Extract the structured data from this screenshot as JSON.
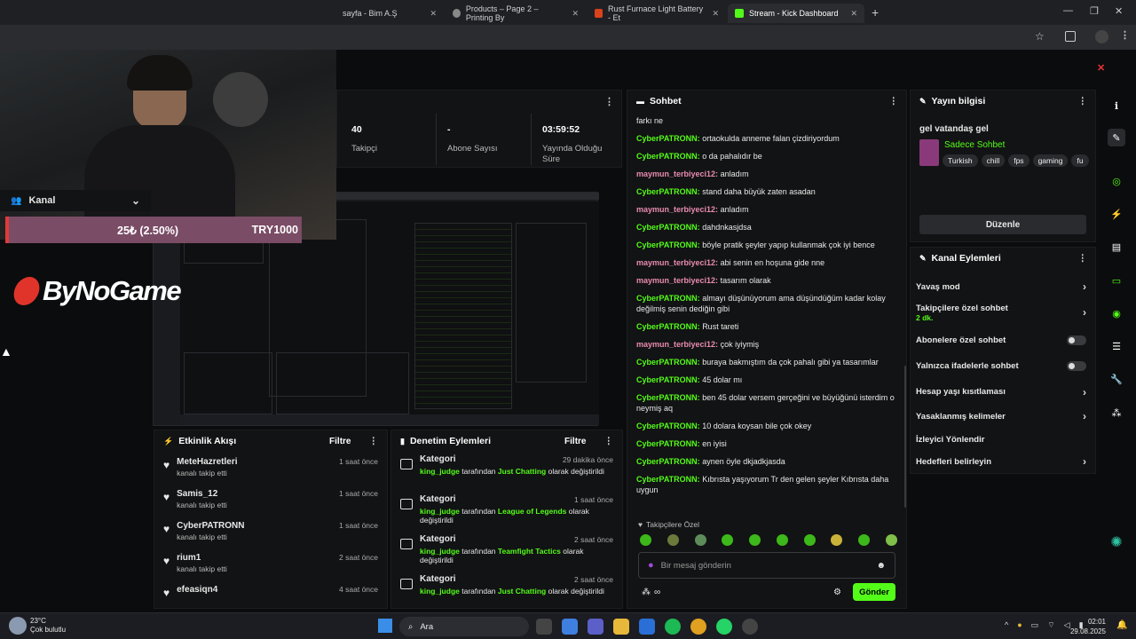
{
  "browser": {
    "tabs": [
      {
        "label": "sayfa - Bim A.Ş",
        "active": false
      },
      {
        "label": "Products – Page 2 – Printing By",
        "active": false
      },
      {
        "label": "Rust Furnace Light Battery - Et",
        "active": false
      },
      {
        "label": "Stream - Kick Dashboard",
        "active": true
      }
    ]
  },
  "overlay": {
    "section_label": "Kanal",
    "donation_amount": "25₺ (2.50%)",
    "donation_goal": "TRY1000",
    "brand_text": "ByNoGame"
  },
  "stats": [
    {
      "value": "40",
      "label": "Takipçi"
    },
    {
      "value": "-",
      "label": "Abone Sayısı"
    },
    {
      "value": "03:59:52",
      "label": "Yayında Olduğu Süre"
    }
  ],
  "activity": {
    "title": "Etkinlik Akışı",
    "filter": "Filtre",
    "items": [
      {
        "name": "MeteHazretleri",
        "action": "kanalı takip etti",
        "time": "1 saat önce"
      },
      {
        "name": "Samis_12",
        "action": "kanalı takip etti",
        "time": "1 saat önce"
      },
      {
        "name": "CyberPATRONN",
        "action": "kanalı takip etti",
        "time": "1 saat önce"
      },
      {
        "name": "rium1",
        "action": "kanalı takip etti",
        "time": "2 saat önce"
      },
      {
        "name": "efeasiqn4",
        "action": "",
        "time": "4 saat önce"
      }
    ]
  },
  "moderation": {
    "title": "Denetim Eylemleri",
    "filter": "Filtre",
    "items": [
      {
        "title": "Kategori",
        "time": "29 dakika önce",
        "user": "king_judge",
        "mid": "tarafından",
        "target": "Just Chatting",
        "suffix": "olarak değiştirildi"
      },
      {
        "title": "Kategori",
        "time": "1 saat önce",
        "user": "king_judge",
        "mid": "tarafından",
        "target": "League of Legends",
        "suffix": "olarak değiştirildi"
      },
      {
        "title": "Kategori",
        "time": "2 saat önce",
        "user": "king_judge",
        "mid": "tarafından",
        "target": "Teamfight Tactics",
        "suffix": "olarak değiştirildi"
      },
      {
        "title": "Kategori",
        "time": "2 saat önce",
        "user": "king_judge",
        "mid": "tarafından",
        "target": "Just Chatting",
        "suffix": "olarak değiştirildi"
      }
    ]
  },
  "chat": {
    "title": "Sohbet",
    "messages": [
      {
        "user": "",
        "text": "farkı ne",
        "color": "green"
      },
      {
        "user": "CyberPATRONN:",
        "text": "ortaokulda anneme falan çizdiriyordum",
        "color": "green"
      },
      {
        "user": "CyberPATRONN:",
        "text": "o da pahalıdır be",
        "color": "green"
      },
      {
        "user": "maymun_terbiyeci12:",
        "text": "anladım",
        "color": "pink"
      },
      {
        "user": "CyberPATRONN:",
        "text": "stand daha büyük zaten asadan",
        "color": "green"
      },
      {
        "user": "maymun_terbiyeci12:",
        "text": "anladım",
        "color": "pink"
      },
      {
        "user": "CyberPATRONN:",
        "text": "dahdnkasjdsa",
        "color": "green"
      },
      {
        "user": "CyberPATRONN:",
        "text": "böyle pratik şeyler yapıp kullanmak çok iyi bence",
        "color": "green"
      },
      {
        "user": "maymun_terbiyeci12:",
        "text": "abi senin en hoşuna gide nne",
        "color": "pink"
      },
      {
        "user": "maymun_terbiyeci12:",
        "text": "tasarım olarak",
        "color": "pink"
      },
      {
        "user": "CyberPATRONN:",
        "text": "almayı düşünüyorum ama düşündüğüm kadar kolay değilmiş senin dediğin gibi",
        "color": "green"
      },
      {
        "user": "CyberPATRONN:",
        "text": "Rust tareti",
        "color": "green"
      },
      {
        "user": "maymun_terbiyeci12:",
        "text": "çok iyiymiş",
        "color": "pink"
      },
      {
        "user": "CyberPATRONN:",
        "text": "buraya bakmıştım da çok pahalı gibi ya tasarımlar",
        "color": "green"
      },
      {
        "user": "CyberPATRONN:",
        "text": "45 dolar mı",
        "color": "green"
      },
      {
        "user": "CyberPATRONN:",
        "text": "ben 45 dolar versem gerçeğini ve büyüğünü isterdim o neymiş aq",
        "color": "green"
      },
      {
        "user": "CyberPATRONN:",
        "text": "10 dolara koysan bile çok okey",
        "color": "green"
      },
      {
        "user": "CyberPATRONN:",
        "text": "en iyisi",
        "color": "green"
      },
      {
        "user": "CyberPATRONN:",
        "text": "aynen öyle dkjadkjasda",
        "color": "green"
      },
      {
        "user": "CyberPATRONN:",
        "text": "Kıbrısta yaşıyorum Tr den gelen şeyler Kıbrısta daha uygun",
        "color": "green"
      }
    ],
    "followers_only_label": "Takipçilere Özel",
    "input_placeholder": "Bir mesaj gönderin",
    "send_label": "Gönder"
  },
  "stream_info": {
    "title": "Yayın bilgisi",
    "stream_title": "gel vatandaş gel",
    "category": "Sadece Sohbet",
    "tags": [
      "Turkish",
      "chill",
      "fps",
      "gaming",
      "fu"
    ],
    "edit_label": "Düzenle"
  },
  "channel_actions": {
    "title": "Kanal Eylemleri",
    "items": [
      {
        "label": "Yavaş mod",
        "sub": "",
        "control": "chevron"
      },
      {
        "label": "Takipçilere özel sohbet",
        "sub": "2 dk.",
        "control": "chevron"
      },
      {
        "label": "Abonelere özel sohbet",
        "sub": "",
        "control": "toggle"
      },
      {
        "label": "Yalnızca ifadelerle sohbet",
        "sub": "",
        "control": "toggle"
      },
      {
        "label": "Hesap yaşı kısıtlaması",
        "sub": "",
        "control": "chevron"
      },
      {
        "label": "Yasaklanmış kelimeler",
        "sub": "",
        "control": "chevron"
      },
      {
        "label": "İzleyici Yönlendir",
        "sub": "",
        "control": "none"
      },
      {
        "label": "Hedefleri belirleyin",
        "sub": "",
        "control": "chevron"
      }
    ]
  },
  "taskbar": {
    "weather_temp": "23°C",
    "weather_desc": "Çok bulutlu",
    "search_placeholder": "Ara",
    "time": "02:01",
    "date": "29.08.2025"
  }
}
